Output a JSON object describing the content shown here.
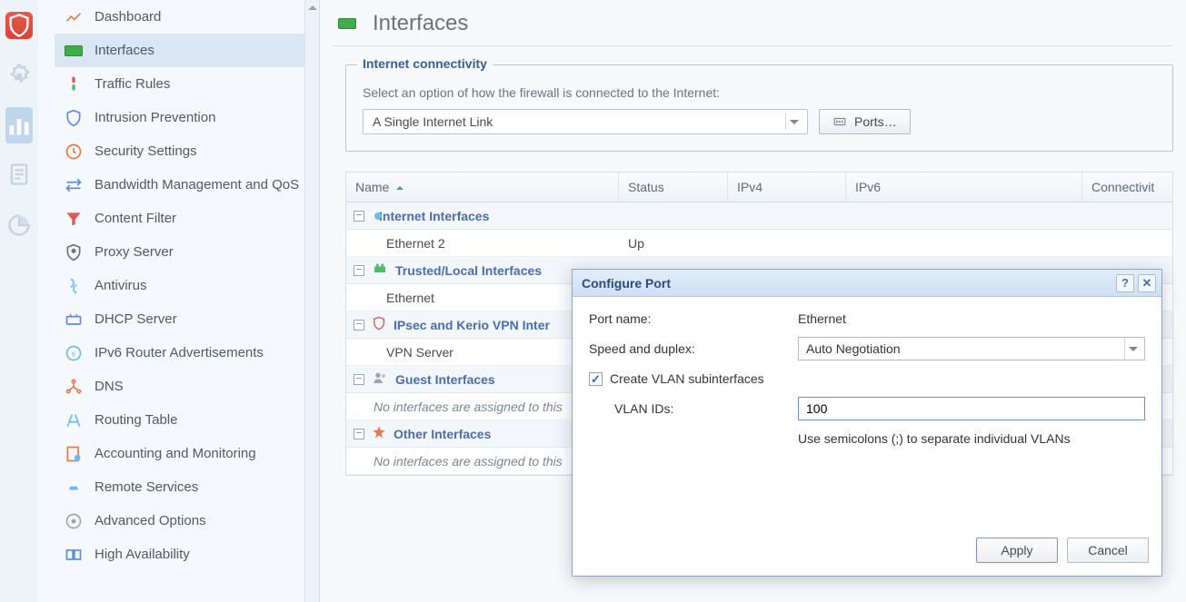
{
  "railIcons": [
    "shield",
    "settings",
    "stats",
    "document",
    "disk"
  ],
  "sidebar": {
    "items": [
      {
        "key": "dashboard",
        "label": "Dashboard"
      },
      {
        "key": "interfaces",
        "label": "Interfaces"
      },
      {
        "key": "traffic-rules",
        "label": "Traffic Rules"
      },
      {
        "key": "intrusion-prevention",
        "label": "Intrusion Prevention"
      },
      {
        "key": "security-settings",
        "label": "Security Settings"
      },
      {
        "key": "bandwidth",
        "label": "Bandwidth Management and QoS"
      },
      {
        "key": "content-filter",
        "label": "Content Filter"
      },
      {
        "key": "proxy-server",
        "label": "Proxy Server"
      },
      {
        "key": "antivirus",
        "label": "Antivirus"
      },
      {
        "key": "dhcp-server",
        "label": "DHCP Server"
      },
      {
        "key": "ipv6-ra",
        "label": "IPv6 Router Advertisements"
      },
      {
        "key": "dns",
        "label": "DNS"
      },
      {
        "key": "routing-table",
        "label": "Routing Table"
      },
      {
        "key": "accounting",
        "label": "Accounting and Monitoring"
      },
      {
        "key": "remote-services",
        "label": "Remote Services"
      },
      {
        "key": "advanced-options",
        "label": "Advanced Options"
      },
      {
        "key": "high-availability",
        "label": "High Availability"
      }
    ],
    "selected": "interfaces"
  },
  "page": {
    "title": "Interfaces"
  },
  "connectivity": {
    "legend": "Internet connectivity",
    "hint": "Select an option of how the firewall is connected to the Internet:",
    "selected": "A Single Internet Link",
    "portsBtn": "Ports…"
  },
  "table": {
    "columns": {
      "name": "Name",
      "status": "Status",
      "ipv4": "IPv4",
      "ipv6": "IPv6",
      "connectivity": "Connectivit"
    },
    "groups": [
      {
        "key": "internet",
        "label": "Internet Interfaces",
        "rows": [
          {
            "name": "Ethernet 2",
            "status": "Up",
            "ipv4": "",
            "ipv6": ""
          }
        ]
      },
      {
        "key": "trusted",
        "label": "Trusted/Local Interfaces",
        "rows": [
          {
            "name": "Ethernet",
            "status": "",
            "ipv4": "",
            "ipv6": ""
          }
        ]
      },
      {
        "key": "ipsec",
        "label": "IPsec and Kerio VPN Inter",
        "rows": [
          {
            "name": "VPN Server",
            "status": "",
            "ipv4": "",
            "ipv6": ""
          }
        ]
      },
      {
        "key": "guest",
        "label": "Guest Interfaces",
        "empty": "No interfaces are assigned to this"
      },
      {
        "key": "other",
        "label": "Other Interfaces",
        "empty": "No interfaces are assigned to this"
      }
    ]
  },
  "dialog": {
    "title": "Configure Port",
    "portNameLabel": "Port name:",
    "portNameValue": "Ethernet",
    "speedLabel": "Speed and duplex:",
    "speedValue": "Auto Negotiation",
    "createVlanLabel": "Create VLAN subinterfaces",
    "vlanIdsLabel": "VLAN IDs:",
    "vlanIdsValue": "100",
    "vlanHint": "Use semicolons (;) to separate individual VLANs",
    "applyBtn": "Apply",
    "cancelBtn": "Cancel"
  }
}
